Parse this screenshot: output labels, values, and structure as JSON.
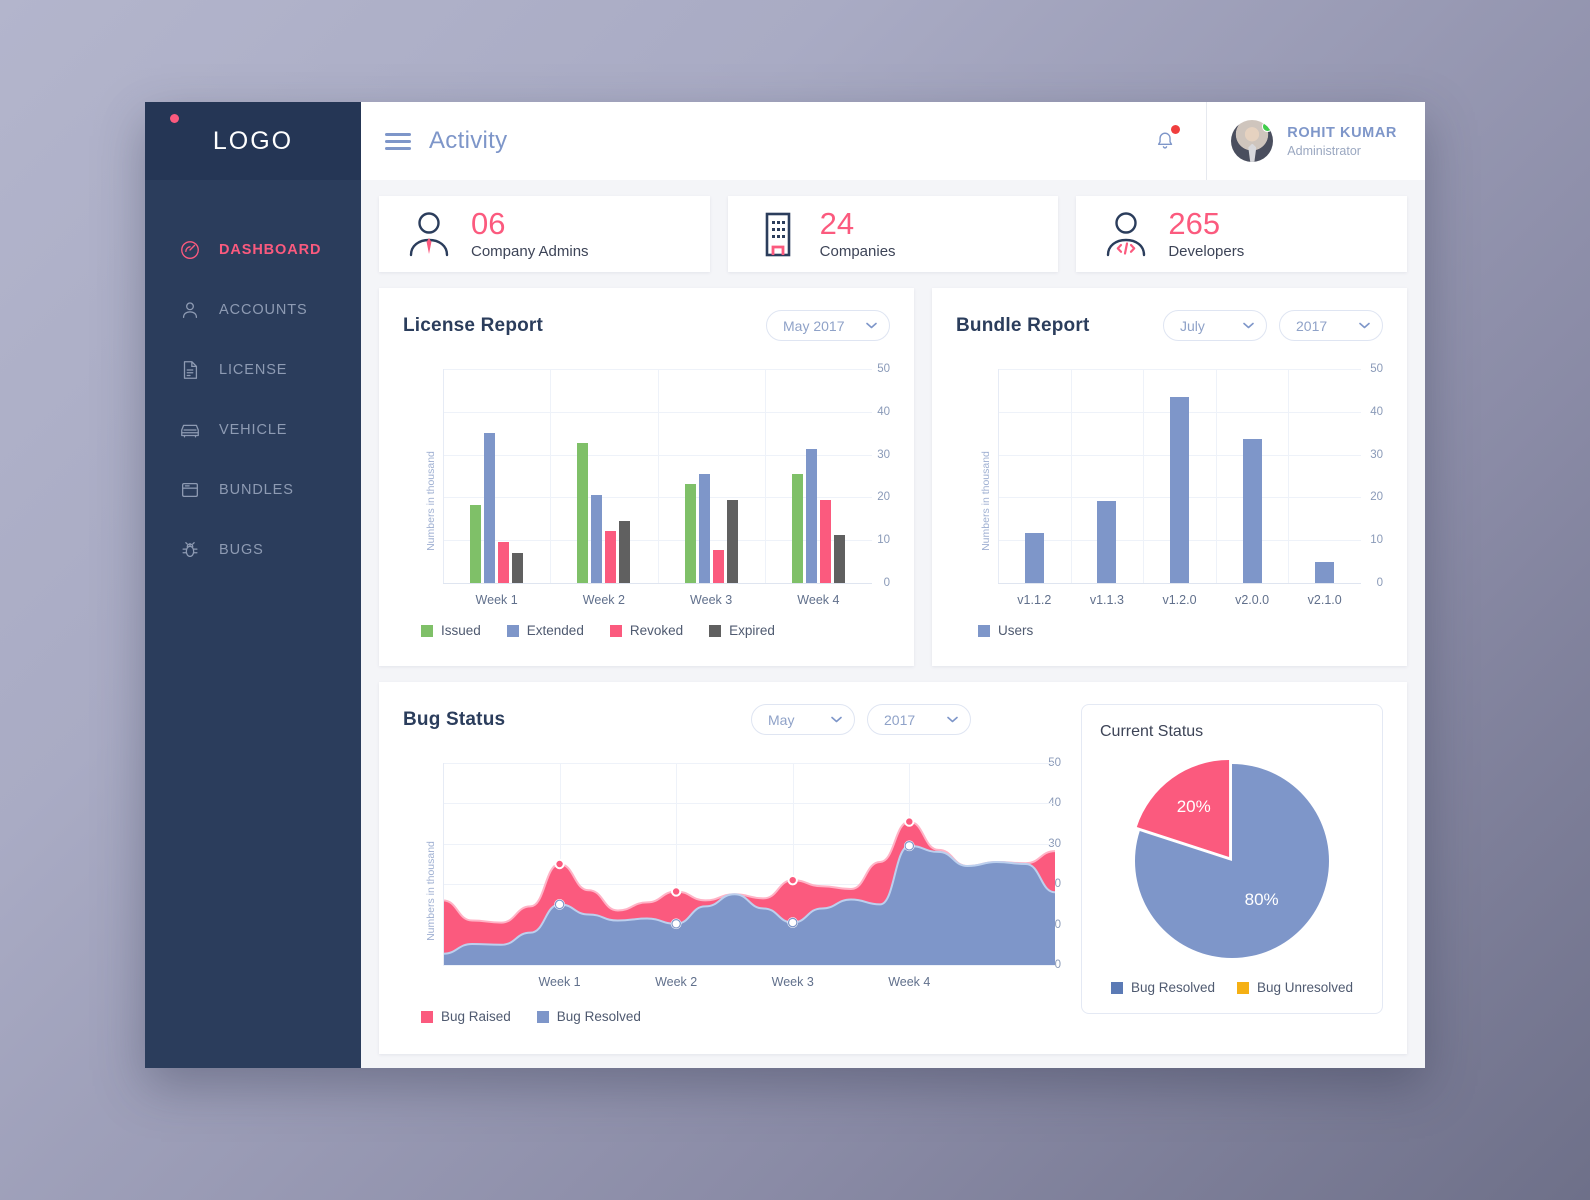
{
  "sidebar": {
    "logo": "LOGO",
    "items": [
      {
        "label": "DASHBOARD",
        "icon": "speedometer-icon",
        "active": true
      },
      {
        "label": "ACCOUNTS",
        "icon": "user-icon",
        "active": false
      },
      {
        "label": "LICENSE",
        "icon": "document-icon",
        "active": false
      },
      {
        "label": "VEHICLE",
        "icon": "car-icon",
        "active": false
      },
      {
        "label": "BUNDLES",
        "icon": "box-icon",
        "active": false
      },
      {
        "label": "BUGS",
        "icon": "bug-icon",
        "active": false
      }
    ]
  },
  "topbar": {
    "menu_icon": "hamburger-icon",
    "title": "Activity",
    "notification_icon": "bell-icon",
    "has_notification": true,
    "user": {
      "name": "ROHIT KUMAR",
      "role": "Administrator",
      "status": "online"
    }
  },
  "stats": [
    {
      "value": "06",
      "label": "Company Admins",
      "icon": "admin-person-icon"
    },
    {
      "value": "24",
      "label": "Companies",
      "icon": "building-icon"
    },
    {
      "value": "265",
      "label": "Developers",
      "icon": "developer-code-icon"
    }
  ],
  "license_panel": {
    "title": "License Report",
    "dropdown": {
      "value": "May  2017",
      "icon": "chevron-down-icon"
    }
  },
  "bundle_panel": {
    "title": "Bundle Report",
    "month_dropdown": {
      "value": "July",
      "icon": "chevron-down-icon"
    },
    "year_dropdown": {
      "value": "2017",
      "icon": "chevron-down-icon"
    }
  },
  "bug_panel": {
    "title": "Bug Status",
    "month_dropdown": {
      "value": "May",
      "icon": "chevron-down-icon"
    },
    "year_dropdown": {
      "value": "2017",
      "icon": "chevron-down-icon"
    },
    "status_card_title": "Current Status"
  },
  "colors": {
    "accent_pink": "#fb5a7e",
    "sidebar": "#2b3d5c",
    "sidebar_logo": "#253655",
    "issued_green": "#7fc068",
    "extended_blue": "#7e96c9",
    "revoked_pink": "#fb5a7e",
    "expired_gray": "#606060",
    "bug_unresolved_yellow": "#f5b014",
    "page_bg": "#f4f5f8"
  },
  "chart_data": [
    {
      "type": "bar",
      "id": "license-report",
      "title": "License Report",
      "xlabel": "",
      "ylabel": "Numbers in thousand",
      "ylim": [
        0,
        50
      ],
      "yticks": [
        0,
        10,
        20,
        30,
        40,
        50
      ],
      "grid": true,
      "legend_position": "bottom-left",
      "categories": [
        "Week 1",
        "Week 2",
        "Week 3",
        "Week 4"
      ],
      "series": [
        {
          "name": "Issued",
          "color": "#7fc068",
          "values": [
            18.3,
            32.6,
            23.1,
            25.4
          ]
        },
        {
          "name": "Extended",
          "color": "#7e96c9",
          "values": [
            35.0,
            20.6,
            25.4,
            31.3
          ]
        },
        {
          "name": "Revoked",
          "color": "#fb5a7e",
          "values": [
            9.6,
            12.1,
            7.6,
            19.5
          ]
        },
        {
          "name": "Expired",
          "color": "#606060",
          "values": [
            7.1,
            14.6,
            19.4,
            11.3
          ]
        }
      ]
    },
    {
      "type": "bar",
      "id": "bundle-report",
      "title": "Bundle Report",
      "xlabel": "",
      "ylabel": "Numbers in thousand",
      "ylim": [
        0,
        50
      ],
      "yticks": [
        0,
        10,
        20,
        30,
        40,
        50
      ],
      "grid": true,
      "legend_position": "bottom-left",
      "categories": [
        "v1.1.2",
        "v1.1.3",
        "v1.2.0",
        "v2.0.0",
        "v2.1.0"
      ],
      "series": [
        {
          "name": "Users",
          "color": "#7e96c9",
          "values": [
            11.8,
            19.2,
            43.4,
            33.6,
            4.9
          ]
        }
      ]
    },
    {
      "type": "area",
      "id": "bug-status",
      "title": "Bug Status",
      "xlabel": "",
      "ylabel": "Numbers in thousand",
      "ylim": [
        0,
        50
      ],
      "yticks": [
        0,
        10,
        20,
        30,
        40,
        50
      ],
      "grid": true,
      "legend_position": "bottom-left",
      "xticks": [
        "Week 1",
        "Week 2",
        "Week 3",
        "Week 4"
      ],
      "series": [
        {
          "name": "Bug Raised",
          "color": "#fb5a7e",
          "values": [
            16.0,
            11.0,
            10.5,
            14.5,
            25.0,
            18.5,
            13.5,
            15.5,
            18.2,
            16.0,
            17.5,
            16.5,
            21.0,
            19.5,
            18.8,
            25.5,
            35.5,
            28.5,
            24.5,
            25.5,
            25.2,
            28.2
          ],
          "markers": [
            {
              "x_index": 4,
              "value": 25.0
            },
            {
              "x_index": 8,
              "value": 18.2
            },
            {
              "x_index": 12,
              "value": 21.0
            },
            {
              "x_index": 16,
              "value": 35.5
            }
          ]
        },
        {
          "name": "Bug Resolved",
          "color": "#7e96c9",
          "values": [
            2.8,
            5.2,
            5.0,
            8.0,
            15.0,
            12.5,
            11.0,
            11.5,
            10.2,
            14.5,
            17.5,
            14.0,
            10.5,
            14.0,
            16.2,
            15.0,
            29.5,
            28.0,
            24.5,
            25.5,
            25.0,
            18.0
          ],
          "markers": [
            {
              "x_index": 4,
              "value": 15.0
            },
            {
              "x_index": 8,
              "value": 10.2
            },
            {
              "x_index": 12,
              "value": 10.5
            },
            {
              "x_index": 16,
              "value": 29.5
            }
          ]
        }
      ]
    },
    {
      "type": "pie",
      "id": "current-status",
      "title": "Current Status",
      "legend_position": "bottom",
      "labels": [
        "Bug Resolved",
        "Bug Unresolved"
      ],
      "values": [
        80,
        20
      ],
      "display_labels": [
        "80%",
        "20%"
      ],
      "slice_colors": [
        "#7e96c9",
        "#fb5a7e"
      ],
      "legend_colors": [
        "#5b7ab5",
        "#f5b014"
      ]
    }
  ]
}
